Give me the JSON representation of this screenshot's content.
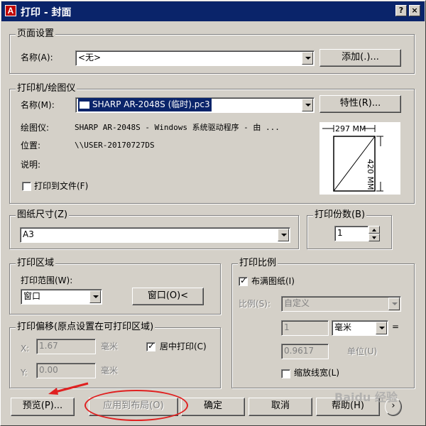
{
  "window": {
    "title": "打印 - 封面",
    "help_glyph": "?",
    "close_glyph": "×"
  },
  "page_setup": {
    "label": "页面设置",
    "name_label": "名称(A):",
    "name_value": "<无>",
    "add_button": "添加(.)..."
  },
  "printer": {
    "label": "打印机/绘图仪",
    "name_label": "名称(M):",
    "name_value": "SHARP AR-2048S (临时).pc3",
    "properties_button": "特性(R)...",
    "plotter_label": "绘图仪:",
    "plotter_value": "SHARP AR-2048S - Windows 系统驱动程序 - 由 ...",
    "location_label": "位置:",
    "location_value": "\\\\USER-20170727DS",
    "description_label": "说明:",
    "print_to_file_label": "打印到文件(F)",
    "print_to_file_checked": false,
    "preview_width": "297 MM",
    "preview_height": "420 MM"
  },
  "paper_size": {
    "label": "图纸尺寸(Z)",
    "value": "A3"
  },
  "copies": {
    "label": "打印份数(B)",
    "value": "1"
  },
  "plot_area": {
    "label": "打印区域",
    "range_label": "打印范围(W):",
    "range_value": "窗口",
    "window_button": "窗口(O)<"
  },
  "plot_offset": {
    "label": "打印偏移(原点设置在可打印区域)",
    "x_label": "X:",
    "x_value": "1.67",
    "x_unit": "毫米",
    "y_label": "Y:",
    "y_value": "0.00",
    "y_unit": "毫米",
    "center_label": "居中打印(C)",
    "center_checked": true
  },
  "plot_scale": {
    "label": "打印比例",
    "fit_label": "布满图纸(I)",
    "fit_checked": true,
    "scale_label": "比例(S):",
    "scale_value": "自定义",
    "value1": "1",
    "unit_value": "毫米",
    "equals": "=",
    "value2": "0.9617",
    "unit_label": "单位(U)",
    "lineweight_label": "缩放线宽(L)",
    "lineweight_checked": false
  },
  "buttons": {
    "preview": "预览(P)...",
    "apply_layout": "应用到布局(O)",
    "ok": "确定",
    "cancel": "取消",
    "help": "帮助(H)",
    "more_glyph": "›"
  },
  "watermark": "Baidu 经验",
  "colors": {
    "title_bar": "#0a246a",
    "annotation_red": "#e02020",
    "face": "#d4d0c8"
  }
}
